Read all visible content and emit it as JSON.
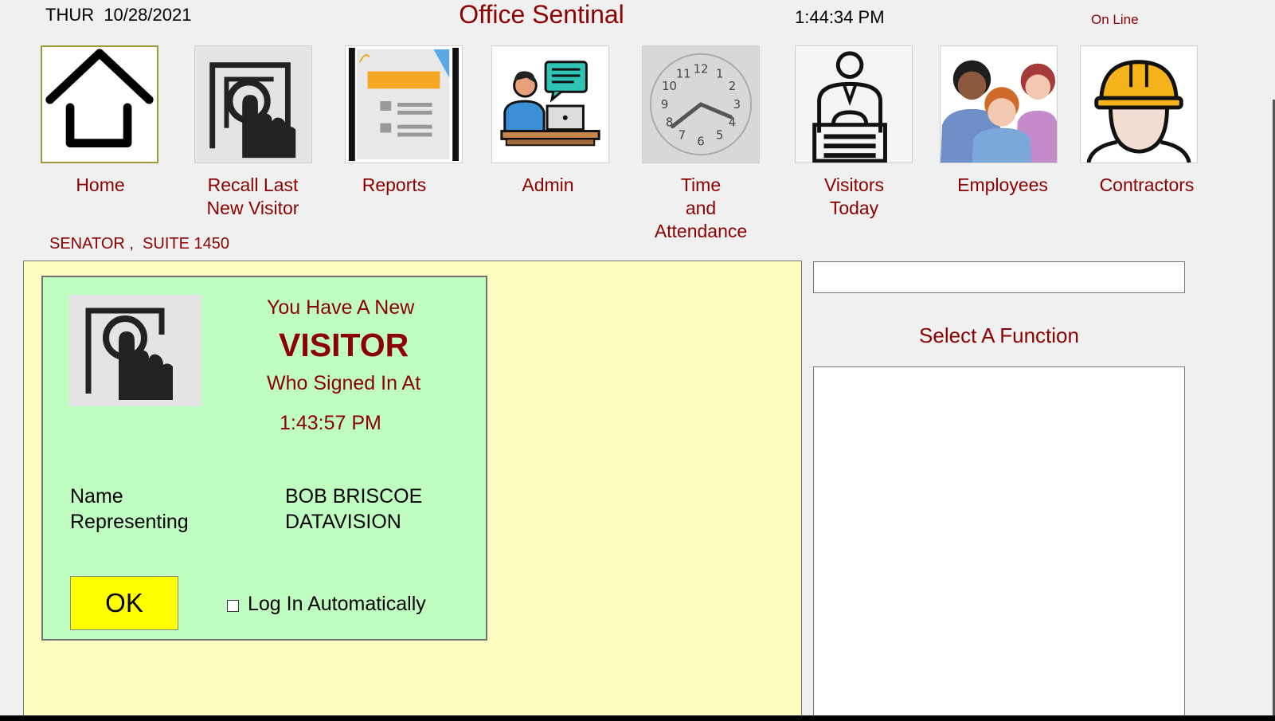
{
  "header": {
    "date": "THUR  10/28/2021",
    "title": "Office Sentinal",
    "time": "1:44:34 PM",
    "status": "On Line"
  },
  "nav": [
    {
      "name": "home",
      "line1": "Home",
      "line2": "",
      "line3": "",
      "icon": "house-icon"
    },
    {
      "name": "recall-last-new-visitor",
      "line1": "Recall Last",
      "line2": "New Visitor",
      "line3": "",
      "icon": "touch-screen-icon"
    },
    {
      "name": "reports",
      "line1": "Reports",
      "line2": "",
      "line3": "",
      "icon": "report-document-icon"
    },
    {
      "name": "admin",
      "line1": "Admin",
      "line2": "",
      "line3": "",
      "icon": "admin-person-laptop-icon"
    },
    {
      "name": "time-and-attendance",
      "line1": "Time",
      "line2": "and",
      "line3": "Attendance",
      "icon": "clock-icon"
    },
    {
      "name": "visitors-today",
      "line1": "Visitors",
      "line2": "Today",
      "line3": "",
      "icon": "receptionist-desk-icon"
    },
    {
      "name": "employees",
      "line1": "Employees",
      "line2": "",
      "line3": "",
      "icon": "people-group-icon"
    },
    {
      "name": "contractors",
      "line1": "Contractors",
      "line2": "",
      "line3": "",
      "icon": "hard-hat-worker-icon"
    }
  ],
  "location": "SENATOR ,  SUITE 1450",
  "notice": {
    "line1": "You Have A New",
    "headline": "VISITOR",
    "line2": "Who Signed In At",
    "signin_time": "1:43:57 PM",
    "name_label": "Name",
    "name_value": "BOB BRISCOE",
    "rep_label": "Representing",
    "rep_value": "DATAVISION",
    "ok_label": "OK",
    "auto_login_label": "Log In Automatically",
    "auto_login_checked": false
  },
  "right_panel": {
    "input_value": "",
    "select_function_label": "Select A Function",
    "function_list_items": []
  },
  "colors": {
    "accent": "#8b0000",
    "main_panel_bg": "#ffffc2",
    "notice_bg": "#c0fdc0",
    "ok_button_bg": "#ffff00"
  }
}
